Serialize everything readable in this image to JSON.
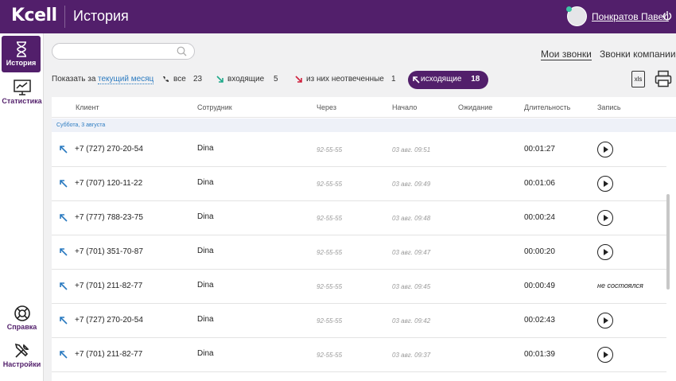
{
  "header": {
    "logo": "Kcell",
    "title": "История",
    "user": "Понкратов Павел"
  },
  "sidebar": [
    {
      "label": "История",
      "icon": "hourglass-icon"
    },
    {
      "label": "Статистика",
      "icon": "chart-monitor-icon"
    },
    {
      "label": "Справка",
      "icon": "lifebuoy-icon"
    },
    {
      "label": "Настройки",
      "icon": "tools-icon"
    }
  ],
  "search": {
    "placeholder": ""
  },
  "tabs": {
    "my_calls": "Мои звонки",
    "company_calls": "Звонки компании"
  },
  "filters": {
    "show_for": "Показать за",
    "period": "текущий месяц",
    "all_label": "все",
    "all_count": "23",
    "incoming_label": "входящие",
    "incoming_count": "5",
    "missed_label": "из них неотвеченные",
    "missed_count": "1",
    "outgoing_label": "исходящие",
    "outgoing_count": "18"
  },
  "export": {
    "xls": "xls"
  },
  "table": {
    "headers": [
      "Клиент",
      "Сотрудник",
      "Через",
      "Начало",
      "Ожидание",
      "Длительность",
      "Запись"
    ],
    "date_group": "Суббота, 3 августа",
    "rows": [
      {
        "client": "+7 (727) 270-20-54",
        "employee": "Dina",
        "via": "92-55-55",
        "start": "03 авг. 09:51",
        "wait": "",
        "duration": "00:01:27",
        "record": ""
      },
      {
        "client": "+7 (707) 120-11-22",
        "employee": "Dina",
        "via": "92-55-55",
        "start": "03 авг. 09:49",
        "wait": "",
        "duration": "00:01:06",
        "record": ""
      },
      {
        "client": "+7 (777) 788-23-75",
        "employee": "Dina",
        "via": "92-55-55",
        "start": "03 авг. 09:48",
        "wait": "",
        "duration": "00:00:24",
        "record": ""
      },
      {
        "client": "+7 (701) 351-70-87",
        "employee": "Dina",
        "via": "92-55-55",
        "start": "03 авг. 09:47",
        "wait": "",
        "duration": "00:00:20",
        "record": ""
      },
      {
        "client": "+7 (701) 211-82-77",
        "employee": "Dina",
        "via": "92-55-55",
        "start": "03 авг. 09:45",
        "wait": "",
        "duration": "00:00:49",
        "record": "не состоялся"
      },
      {
        "client": "+7 (727) 270-20-54",
        "employee": "Dina",
        "via": "92-55-55",
        "start": "03 авг. 09:42",
        "wait": "",
        "duration": "00:02:43",
        "record": ""
      },
      {
        "client": "+7 (701) 211-82-77",
        "employee": "Dina",
        "via": "92-55-55",
        "start": "03 авг. 09:37",
        "wait": "",
        "duration": "00:01:39",
        "record": ""
      }
    ]
  },
  "colors": {
    "brand": "#521f6b",
    "link": "#2a7ac0",
    "incoming": "#1fa98a",
    "missed": "#d0213d"
  }
}
